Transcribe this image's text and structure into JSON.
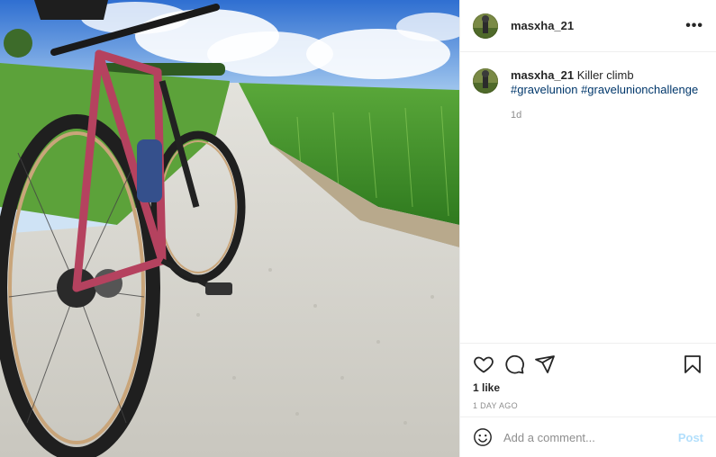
{
  "photo": {
    "alt": "Bicycle on a gravel road between green fields",
    "colors": {
      "sky": "#3f7fd6",
      "field": "#4f9a2d",
      "road": "#d6d4cc",
      "frame": "#b5425f"
    }
  },
  "header": {
    "username": "masxha_21",
    "more_label": "•••"
  },
  "caption": {
    "username": "masxha_21",
    "text": " Killer climb ",
    "hashtags": [
      "#gravelunion",
      "#gravelunionchallenge"
    ],
    "time": "1d"
  },
  "actions": {
    "icons": [
      "heart-icon",
      "comment-icon",
      "share-icon",
      "bookmark-icon"
    ],
    "likes": "1 like",
    "date": "1 DAY AGO"
  },
  "comment_box": {
    "placeholder": "Add a comment...",
    "post_label": "Post"
  },
  "colors": {
    "text": "#262626",
    "muted": "#8e8e8e",
    "link": "#00376b",
    "post_disabled": "#b2dffc",
    "border": "#efefef"
  }
}
